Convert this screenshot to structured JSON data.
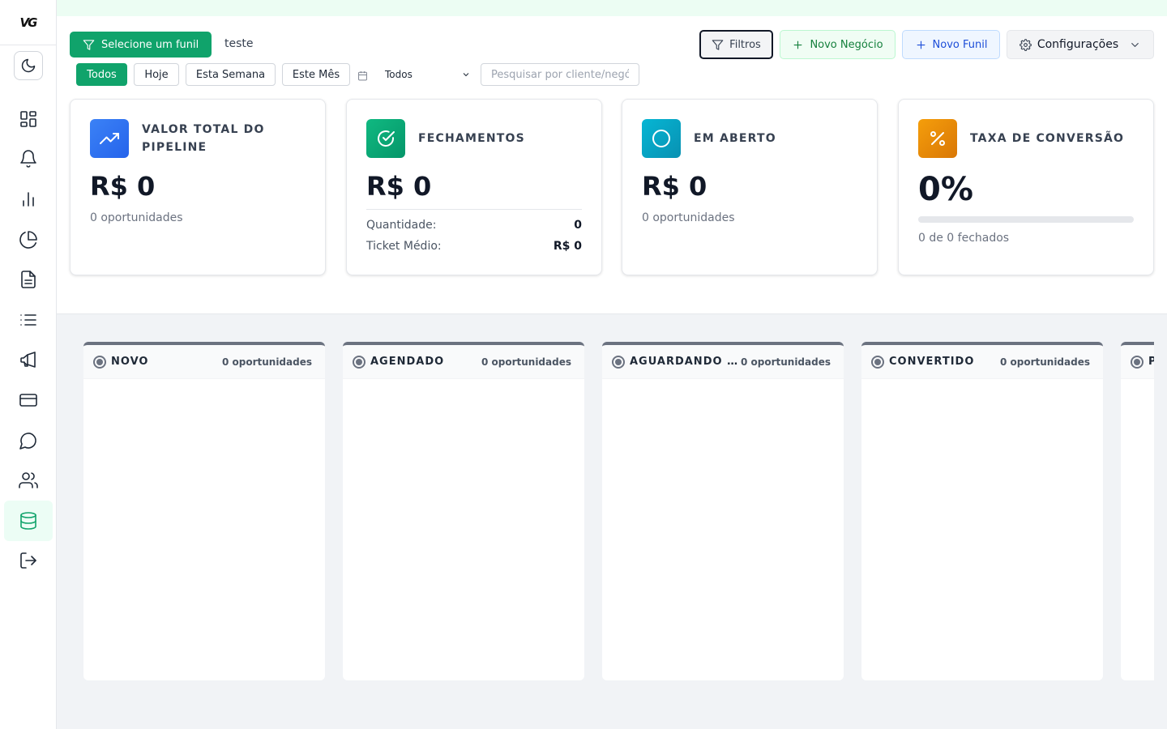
{
  "app": {
    "logo_text": "VG"
  },
  "sidebar": {
    "items": [
      {
        "name": "dashboard",
        "icon": "dashboard-grid-icon",
        "active": false
      },
      {
        "name": "notifications",
        "icon": "bell-icon",
        "active": false
      },
      {
        "name": "reports",
        "icon": "bar-chart-icon",
        "active": false
      },
      {
        "name": "analytics",
        "icon": "pie-chart-icon",
        "active": false
      },
      {
        "name": "documents",
        "icon": "file-text-icon",
        "active": false
      },
      {
        "name": "list",
        "icon": "list-icon",
        "active": false
      },
      {
        "name": "campaigns",
        "icon": "megaphone-icon",
        "active": false
      },
      {
        "name": "payments",
        "icon": "credit-card-icon",
        "active": false
      },
      {
        "name": "chat",
        "icon": "message-circle-icon",
        "active": false
      },
      {
        "name": "contacts",
        "icon": "users-icon",
        "active": false
      },
      {
        "name": "database",
        "icon": "database-icon",
        "active": true
      },
      {
        "name": "logout",
        "icon": "logout-icon",
        "active": false
      }
    ]
  },
  "toolbar": {
    "select_funnel_label": "Selecione um funil",
    "funnel_name": "teste",
    "filters_label": "Filtros",
    "new_deal_label": "Novo Negócio",
    "new_funnel_label": "Novo Funil",
    "settings_label": "Configurações"
  },
  "filters": {
    "periods": [
      "Todos",
      "Hoje",
      "Esta Semana",
      "Este Mês"
    ],
    "active_period": "Todos",
    "select_value": "Todos",
    "search_placeholder": "Pesquisar por cliente/negócio"
  },
  "stats": {
    "pipeline": {
      "title": "VALOR TOTAL DO PIPELINE",
      "value": "R$ 0",
      "subtitle": "0 oportunidades"
    },
    "closings": {
      "title": "FECHAMENTOS",
      "value": "R$ 0",
      "quantity_label": "Quantidade:",
      "quantity_value": "0",
      "ticket_label": "Ticket Médio:",
      "ticket_value": "R$ 0"
    },
    "open": {
      "title": "EM ABERTO",
      "value": "R$ 0",
      "subtitle": "0 oportunidades"
    },
    "conversion": {
      "title": "TAXA DE CONVERSÃO",
      "value": "0%",
      "progress": 0,
      "subtitle": "0 de 0 fechados"
    }
  },
  "colors": {
    "brand_green": "#10a36b",
    "pipeline_icon": "#3b82f6",
    "closings_icon": "#10b981",
    "open_icon": "#06b6d4",
    "conversion_icon": "#f59e0b"
  },
  "kanban": {
    "columns": [
      {
        "name": "NOVO",
        "count": "0 oportunidades"
      },
      {
        "name": "AGENDADO",
        "count": "0 oportunidades"
      },
      {
        "name": "AGUARDANDO ...",
        "count": "0 oportunidades"
      },
      {
        "name": "CONVERTIDO",
        "count": "0 oportunidades"
      },
      {
        "name": "P",
        "count": ""
      }
    ]
  }
}
